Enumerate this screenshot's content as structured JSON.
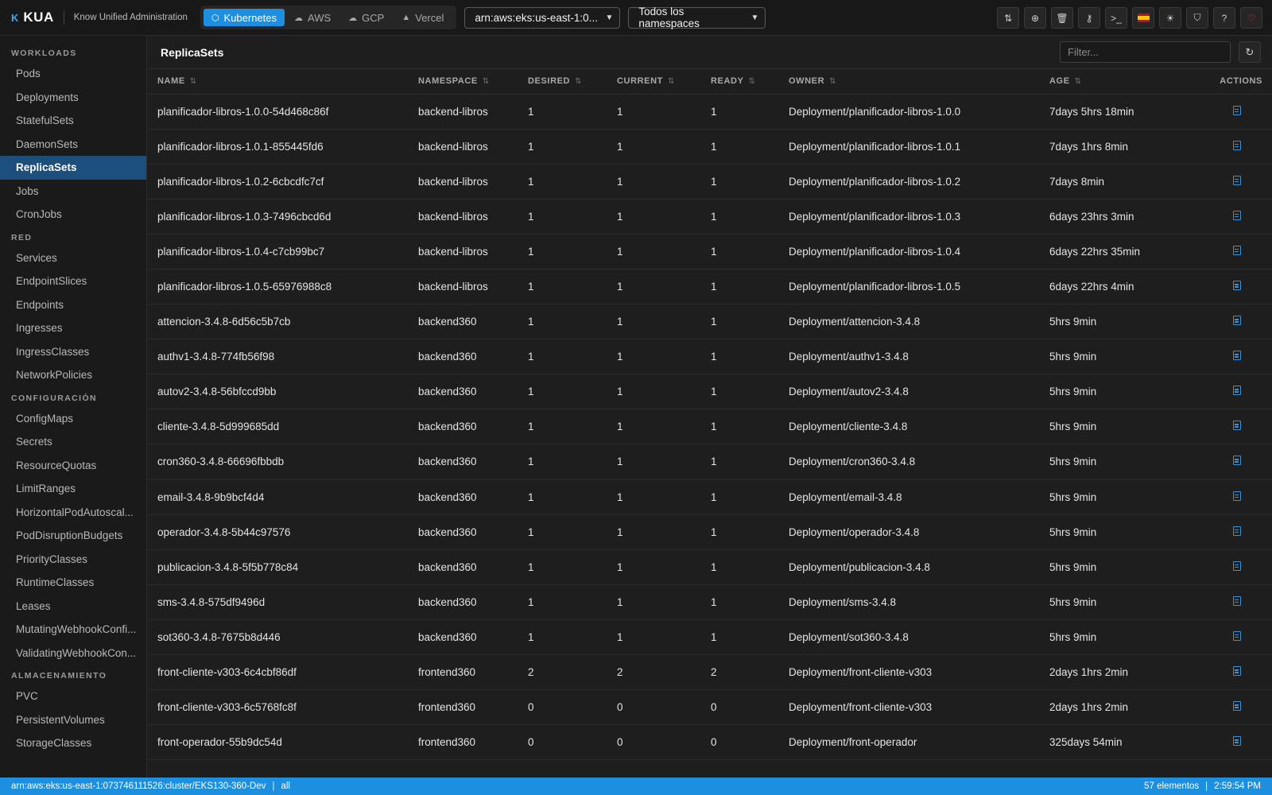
{
  "app": {
    "logo_mark": "K",
    "name": "KUA",
    "subtitle": "Know Unified Administration"
  },
  "providers": [
    {
      "label": "Kubernetes",
      "icon": "cube-icon",
      "active": true
    },
    {
      "label": "AWS",
      "icon": "cloud-icon",
      "active": false
    },
    {
      "label": "GCP",
      "icon": "cloud-upload-icon",
      "active": false
    },
    {
      "label": "Vercel",
      "icon": "triangle-icon",
      "active": false
    }
  ],
  "cluster_select": {
    "value": "arn:aws:eks:us-east-1:0..."
  },
  "namespace_select": {
    "value": "Todos los namespaces"
  },
  "toolbar_icons": [
    "swap-icon",
    "plus-circle-icon",
    "trash-icon",
    "key-icon",
    "terminal-icon",
    "spain-flag-icon",
    "sun-icon",
    "shield-icon",
    "help-icon",
    "heart-icon"
  ],
  "sidebar": {
    "sections": [
      {
        "title": "WORKLOADS",
        "items": [
          "Pods",
          "Deployments",
          "StatefulSets",
          "DaemonSets",
          "ReplicaSets",
          "Jobs",
          "CronJobs"
        ]
      },
      {
        "title": "RED",
        "items": [
          "Services",
          "EndpointSlices",
          "Endpoints",
          "Ingresses",
          "IngressClasses",
          "NetworkPolicies"
        ]
      },
      {
        "title": "CONFIGURACIÓN",
        "items": [
          "ConfigMaps",
          "Secrets",
          "ResourceQuotas",
          "LimitRanges",
          "HorizontalPodAutoscal...",
          "PodDisruptionBudgets",
          "PriorityClasses",
          "RuntimeClasses",
          "Leases",
          "MutatingWebhookConfi...",
          "ValidatingWebhookCon..."
        ]
      },
      {
        "title": "ALMACENAMIENTO",
        "items": [
          "PVC",
          "PersistentVolumes",
          "StorageClasses"
        ]
      }
    ],
    "active_item": "ReplicaSets"
  },
  "main": {
    "title": "ReplicaSets",
    "filter_placeholder": "Filter...",
    "columns": [
      "NAME",
      "NAMESPACE",
      "DESIRED",
      "CURRENT",
      "READY",
      "OWNER",
      "AGE"
    ],
    "actions_header": "ACTIONS",
    "rows": [
      {
        "name": "planificador-libros-1.0.0-54d468c86f",
        "namespace": "backend-libros",
        "desired": "1",
        "current": "1",
        "ready": "1",
        "owner": "Deployment/planificador-libros-1.0.0",
        "age": "7days 5hrs 18min"
      },
      {
        "name": "planificador-libros-1.0.1-855445fd6",
        "namespace": "backend-libros",
        "desired": "1",
        "current": "1",
        "ready": "1",
        "owner": "Deployment/planificador-libros-1.0.1",
        "age": "7days 1hrs 8min"
      },
      {
        "name": "planificador-libros-1.0.2-6cbcdfc7cf",
        "namespace": "backend-libros",
        "desired": "1",
        "current": "1",
        "ready": "1",
        "owner": "Deployment/planificador-libros-1.0.2",
        "age": "7days 8min"
      },
      {
        "name": "planificador-libros-1.0.3-7496cbcd6d",
        "namespace": "backend-libros",
        "desired": "1",
        "current": "1",
        "ready": "1",
        "owner": "Deployment/planificador-libros-1.0.3",
        "age": "6days 23hrs 3min"
      },
      {
        "name": "planificador-libros-1.0.4-c7cb99bc7",
        "namespace": "backend-libros",
        "desired": "1",
        "current": "1",
        "ready": "1",
        "owner": "Deployment/planificador-libros-1.0.4",
        "age": "6days 22hrs 35min"
      },
      {
        "name": "planificador-libros-1.0.5-65976988c8",
        "namespace": "backend-libros",
        "desired": "1",
        "current": "1",
        "ready": "1",
        "owner": "Deployment/planificador-libros-1.0.5",
        "age": "6days 22hrs 4min"
      },
      {
        "name": "attencion-3.4.8-6d56c5b7cb",
        "namespace": "backend360",
        "desired": "1",
        "current": "1",
        "ready": "1",
        "owner": "Deployment/attencion-3.4.8",
        "age": "5hrs 9min"
      },
      {
        "name": "authv1-3.4.8-774fb56f98",
        "namespace": "backend360",
        "desired": "1",
        "current": "1",
        "ready": "1",
        "owner": "Deployment/authv1-3.4.8",
        "age": "5hrs 9min"
      },
      {
        "name": "autov2-3.4.8-56bfccd9bb",
        "namespace": "backend360",
        "desired": "1",
        "current": "1",
        "ready": "1",
        "owner": "Deployment/autov2-3.4.8",
        "age": "5hrs 9min"
      },
      {
        "name": "cliente-3.4.8-5d999685dd",
        "namespace": "backend360",
        "desired": "1",
        "current": "1",
        "ready": "1",
        "owner": "Deployment/cliente-3.4.8",
        "age": "5hrs 9min"
      },
      {
        "name": "cron360-3.4.8-66696fbbdb",
        "namespace": "backend360",
        "desired": "1",
        "current": "1",
        "ready": "1",
        "owner": "Deployment/cron360-3.4.8",
        "age": "5hrs 9min"
      },
      {
        "name": "email-3.4.8-9b9bcf4d4",
        "namespace": "backend360",
        "desired": "1",
        "current": "1",
        "ready": "1",
        "owner": "Deployment/email-3.4.8",
        "age": "5hrs 9min"
      },
      {
        "name": "operador-3.4.8-5b44c97576",
        "namespace": "backend360",
        "desired": "1",
        "current": "1",
        "ready": "1",
        "owner": "Deployment/operador-3.4.8",
        "age": "5hrs 9min"
      },
      {
        "name": "publicacion-3.4.8-5f5b778c84",
        "namespace": "backend360",
        "desired": "1",
        "current": "1",
        "ready": "1",
        "owner": "Deployment/publicacion-3.4.8",
        "age": "5hrs 9min"
      },
      {
        "name": "sms-3.4.8-575df9496d",
        "namespace": "backend360",
        "desired": "1",
        "current": "1",
        "ready": "1",
        "owner": "Deployment/sms-3.4.8",
        "age": "5hrs 9min"
      },
      {
        "name": "sot360-3.4.8-7675b8d446",
        "namespace": "backend360",
        "desired": "1",
        "current": "1",
        "ready": "1",
        "owner": "Deployment/sot360-3.4.8",
        "age": "5hrs 9min"
      },
      {
        "name": "front-cliente-v303-6c4cbf86df",
        "namespace": "frontend360",
        "desired": "2",
        "current": "2",
        "ready": "2",
        "owner": "Deployment/front-cliente-v303",
        "age": "2days 1hrs 2min"
      },
      {
        "name": "front-cliente-v303-6c5768fc8f",
        "namespace": "frontend360",
        "desired": "0",
        "current": "0",
        "ready": "0",
        "owner": "Deployment/front-cliente-v303",
        "age": "2days 1hrs 2min"
      },
      {
        "name": "front-operador-55b9dc54d",
        "namespace": "frontend360",
        "desired": "0",
        "current": "0",
        "ready": "0",
        "owner": "Deployment/front-operador",
        "age": "325days 54min"
      }
    ]
  },
  "statusbar": {
    "cluster": "arn:aws:eks:us-east-1:073746111526:cluster/EKS130-360-Dev",
    "separator": "|",
    "namespace": "all",
    "count": "57 elementos",
    "time": "2:59:54 PM"
  },
  "colors": {
    "accent": "#1c8fe0",
    "sidebar_active": "#1d4f7d",
    "background": "#1e1e1e",
    "action_icon": "#3b8fd6"
  }
}
